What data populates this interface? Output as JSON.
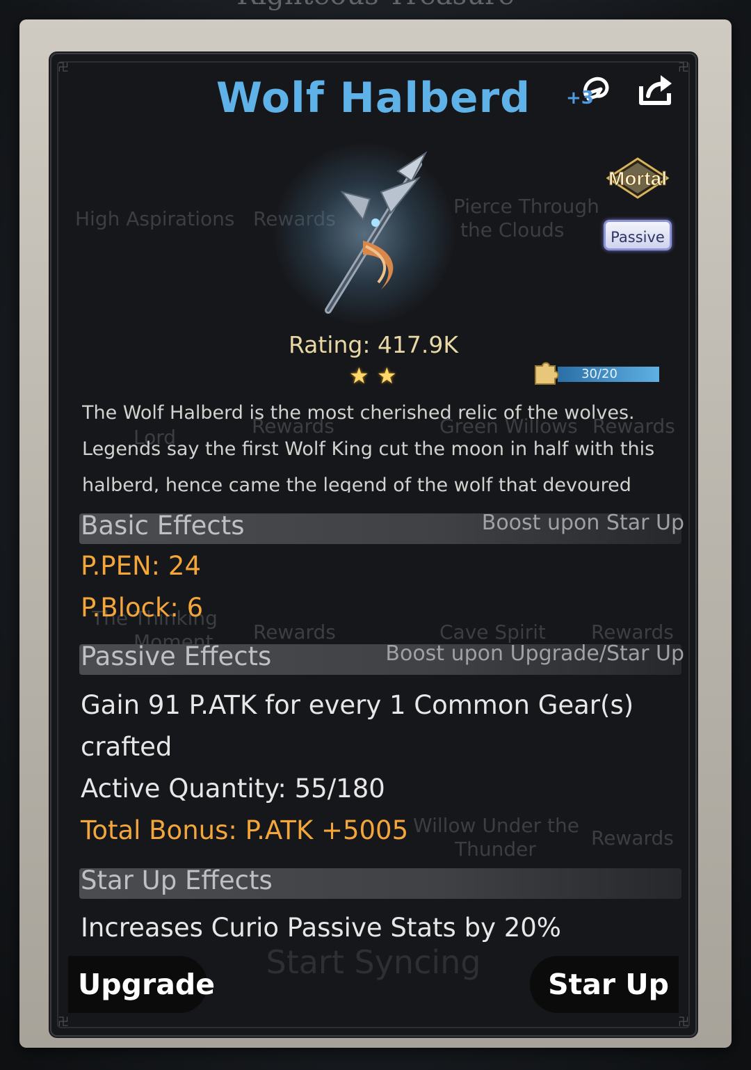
{
  "background": {
    "title": "Righteous Treasure",
    "ghost_texts": [
      "High Aspirations",
      "Rewards",
      "Pierce Through",
      "the Clouds",
      "Lord",
      "Rewards",
      "Green Willows",
      "Rewards",
      "The Thinking",
      "Moment",
      "Rewards",
      "Cave Spirit",
      "Rewards",
      "Willow Under the",
      "Thunder",
      "Rewards",
      "Start Syncing"
    ]
  },
  "item": {
    "name": "Wolf Halberd",
    "upgrade_level": "+3",
    "rarity_badge": "Mortal",
    "type_badge": "Passive",
    "rating": "Rating: 417.9K",
    "stars": 2,
    "fragments": "30/20",
    "fragments_fill": 1.0,
    "description": "The Wolf Halberd is the most cherished relic of the wolves. Legends say the first Wolf King cut the moon in half with this halberd, hence came the legend of the wolf that devoured"
  },
  "basic_effects": {
    "title": "Basic Effects",
    "subtitle": "Boost upon Star Up",
    "stats": [
      "P.PEN: 24",
      "P.Block: 6"
    ]
  },
  "passive_effects": {
    "title": "Passive Effects",
    "subtitle": "Boost upon Upgrade/Star Up",
    "line1": "Gain 91 P.ATK for every 1 Common Gear(s)",
    "line2": "crafted",
    "active_quantity": "Active Quantity: 55/180",
    "total_bonus": "Total Bonus: P.ATK +5005"
  },
  "star_up_effects": {
    "title": "Star Up Effects",
    "line": "Increases Curio Passive Stats by 20%"
  },
  "buttons": {
    "upgrade": "Upgrade",
    "star_up": "Star Up"
  },
  "colors": {
    "title": "#5fb2e8",
    "stat_orange": "#f4a63b",
    "rating": "#e9d7a4",
    "progress": "#5fb0e3"
  }
}
